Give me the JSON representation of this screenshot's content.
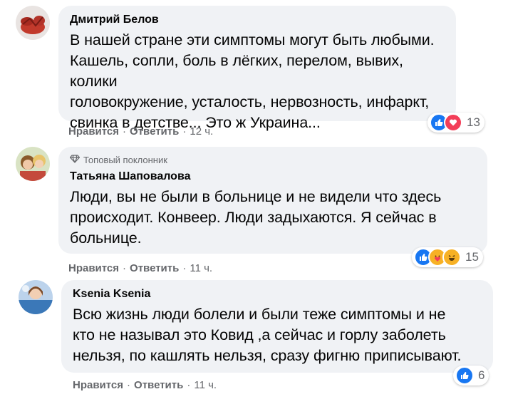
{
  "comments": [
    {
      "author": "Дмитрий Белов",
      "badge": "",
      "lines": [
        "В нашей стране эти симптомы могут быть любыми.",
        "Кашель, сопли, боль в лёгких, перелом, вывих, колики",
        "головокружение, усталость, нервозность, инфаркт,",
        "свинка в детстве... Это ж Украина..."
      ],
      "reactions": [
        "like",
        "love"
      ],
      "reaction_count": "13",
      "like_label": "Нравится",
      "reply_label": "Ответить",
      "time": "12 ч."
    },
    {
      "author": "Татьяна Шаповалова",
      "badge": "Топовый поклонник",
      "lines": [
        "Люди, вы не были в больнице и не видели что здесь",
        "происходит. Конвеер. Люди задыхаются. Я сейчас в",
        "больнице."
      ],
      "reactions": [
        "like",
        "care",
        "haha"
      ],
      "reaction_count": "15",
      "like_label": "Нравится",
      "reply_label": "Ответить",
      "time": "11 ч."
    },
    {
      "author": "Ksenia Ksenia",
      "badge": "",
      "lines": [
        "Всю жизнь люди болели и были теже симптомы и не",
        "кто не называл это Ковид ,а сейчас и горлу заболеть",
        "нельзя, по кашлять нельзя, сразу фигню приписывают."
      ],
      "reactions": [
        "like"
      ],
      "reaction_count": "6",
      "like_label": "Нравится",
      "reply_label": "Ответить",
      "time": "11 ч."
    }
  ],
  "colors": {
    "bubble": "#f0f2f5",
    "secondary_text": "#65676b",
    "like": "#1877f2",
    "love": "#f33e58",
    "care": "#f7b125"
  }
}
